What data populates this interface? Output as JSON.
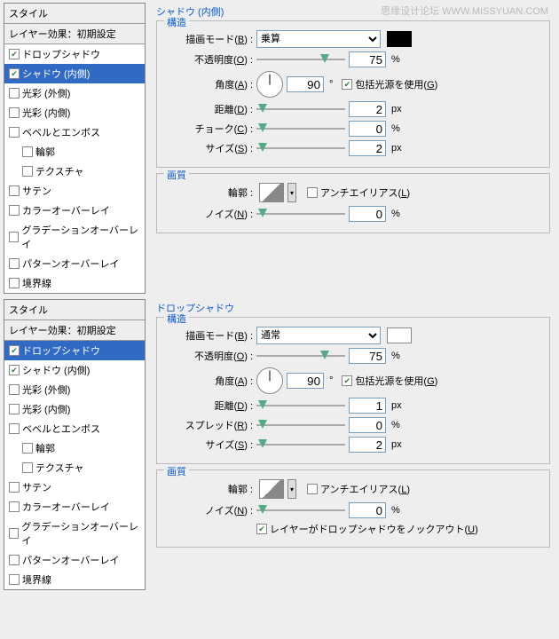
{
  "watermark": "思缘设计论坛  WWW.MISSYUAN.COM",
  "top": {
    "styles_header": "スタイル",
    "styles_sub": "レイヤー効果：初期設定",
    "items": [
      {
        "id": "drop-shadow",
        "label": "ドロップシャドウ",
        "checked": true,
        "selected": false,
        "indent": false
      },
      {
        "id": "inner-shadow",
        "label": "シャドウ (内側)",
        "checked": true,
        "selected": true,
        "indent": false
      },
      {
        "id": "outer-glow",
        "label": "光彩 (外側)",
        "checked": false,
        "selected": false,
        "indent": false
      },
      {
        "id": "inner-glow",
        "label": "光彩 (内側)",
        "checked": false,
        "selected": false,
        "indent": false
      },
      {
        "id": "bevel",
        "label": "ベベルとエンボス",
        "checked": false,
        "selected": false,
        "indent": false
      },
      {
        "id": "contour",
        "label": "輪郭",
        "checked": false,
        "selected": false,
        "indent": true
      },
      {
        "id": "texture",
        "label": "テクスチャ",
        "checked": false,
        "selected": false,
        "indent": true
      },
      {
        "id": "satin",
        "label": "サテン",
        "checked": false,
        "selected": false,
        "indent": false
      },
      {
        "id": "color-ov",
        "label": "カラーオーバーレイ",
        "checked": false,
        "selected": false,
        "indent": false
      },
      {
        "id": "grad-ov",
        "label": "グラデーションオーバーレイ",
        "checked": false,
        "selected": false,
        "indent": false
      },
      {
        "id": "patt-ov",
        "label": "パターンオーバーレイ",
        "checked": false,
        "selected": false,
        "indent": false
      },
      {
        "id": "stroke",
        "label": "境界線",
        "checked": false,
        "selected": false,
        "indent": false
      }
    ],
    "title": "シャドウ (内側)",
    "group_structure": "構造",
    "blend_label": "描画モード(<u>B</u>) :",
    "blend_value": "乗算",
    "opacity_label": "不透明度(<u>O</u>) :",
    "opacity_value": "75",
    "opacity_unit": "%",
    "angle_label": "角度(<u>A</u>) :",
    "angle_value": "90",
    "angle_unit": "°",
    "global_light": "包括光源を使用(<u>G</u>)",
    "distance_label": "距離(<u>D</u>) :",
    "distance_value": "2",
    "distance_unit": "px",
    "choke_label": "チョーク(<u>C</u>) :",
    "choke_value": "0",
    "choke_unit": "%",
    "size_label": "サイズ(<u>S</u>) :",
    "size_value": "2",
    "size_unit": "px",
    "group_quality": "画質",
    "contour_label": "輪郭 :",
    "antialias": "アンチエイリアス(<u>L</u>)",
    "noise_label": "ノイズ(<u>N</u>) :",
    "noise_value": "0",
    "noise_unit": "%"
  },
  "bottom": {
    "styles_header": "スタイル",
    "styles_sub": "レイヤー効果：初期設定",
    "items": [
      {
        "id": "drop-shadow",
        "label": "ドロップシャドウ",
        "checked": true,
        "selected": true,
        "indent": false
      },
      {
        "id": "inner-shadow",
        "label": "シャドウ (内側)",
        "checked": true,
        "selected": false,
        "indent": false
      },
      {
        "id": "outer-glow",
        "label": "光彩 (外側)",
        "checked": false,
        "selected": false,
        "indent": false
      },
      {
        "id": "inner-glow",
        "label": "光彩 (内側)",
        "checked": false,
        "selected": false,
        "indent": false
      },
      {
        "id": "bevel",
        "label": "ベベルとエンボス",
        "checked": false,
        "selected": false,
        "indent": false
      },
      {
        "id": "contour",
        "label": "輪郭",
        "checked": false,
        "selected": false,
        "indent": true
      },
      {
        "id": "texture",
        "label": "テクスチャ",
        "checked": false,
        "selected": false,
        "indent": true
      },
      {
        "id": "satin",
        "label": "サテン",
        "checked": false,
        "selected": false,
        "indent": false
      },
      {
        "id": "color-ov",
        "label": "カラーオーバーレイ",
        "checked": false,
        "selected": false,
        "indent": false
      },
      {
        "id": "grad-ov",
        "label": "グラデーションオーバーレイ",
        "checked": false,
        "selected": false,
        "indent": false
      },
      {
        "id": "patt-ov",
        "label": "パターンオーバーレイ",
        "checked": false,
        "selected": false,
        "indent": false
      },
      {
        "id": "stroke",
        "label": "境界線",
        "checked": false,
        "selected": false,
        "indent": false
      }
    ],
    "title": "ドロップシャドウ",
    "group_structure": "構造",
    "blend_label": "描画モード(<u>B</u>) :",
    "blend_value": "通常",
    "opacity_label": "不透明度(<u>O</u>) :",
    "opacity_value": "75",
    "opacity_unit": "%",
    "angle_label": "角度(<u>A</u>) :",
    "angle_value": "90",
    "angle_unit": "°",
    "global_light": "包括光源を使用(<u>G</u>)",
    "distance_label": "距離(<u>D</u>) :",
    "distance_value": "1",
    "distance_unit": "px",
    "spread_label": "スプレッド(<u>R</u>) :",
    "spread_value": "0",
    "spread_unit": "%",
    "size_label": "サイズ(<u>S</u>) :",
    "size_value": "2",
    "size_unit": "px",
    "group_quality": "画質",
    "contour_label": "輪郭 :",
    "antialias": "アンチエイリアス(<u>L</u>)",
    "noise_label": "ノイズ(<u>N</u>) :",
    "noise_value": "0",
    "noise_unit": "%",
    "knockout": "レイヤーがドロップシャドウをノックアウト(<u>U</u>)"
  }
}
